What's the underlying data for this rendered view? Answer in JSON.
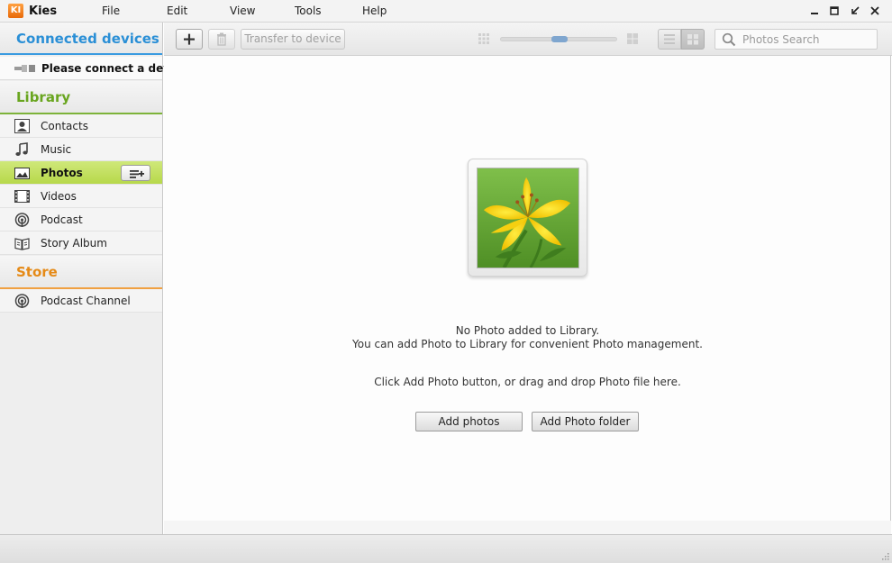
{
  "app": {
    "title": "Kies",
    "logo_text": "KI"
  },
  "menu": [
    "File",
    "Edit",
    "View",
    "Tools",
    "Help"
  ],
  "window_controls": {
    "menu": "▭",
    "minimize": "—",
    "maximize": "◻",
    "restore": "↙",
    "close": "✕"
  },
  "sidebar": {
    "connected_header": "Connected devices",
    "device_label": "Please connect a dev...",
    "library_header": "Library",
    "library_items": [
      {
        "label": "Contacts",
        "icon": "contacts-icon"
      },
      {
        "label": "Music",
        "icon": "music-icon"
      },
      {
        "label": "Photos",
        "icon": "photos-icon",
        "active": true
      },
      {
        "label": "Videos",
        "icon": "videos-icon"
      },
      {
        "label": "Podcast",
        "icon": "podcast-icon"
      },
      {
        "label": "Story Album",
        "icon": "story-album-icon"
      }
    ],
    "store_header": "Store",
    "store_items": [
      {
        "label": "Podcast Channel",
        "icon": "podcast-channel-icon"
      }
    ]
  },
  "toolbar": {
    "transfer_label": "Transfer to device",
    "search_placeholder": "Photos Search"
  },
  "main": {
    "empty_line1": "No Photo added to Library.",
    "empty_line2": "You can add Photo to Library for convenient Photo management.",
    "empty_line3": "Click Add Photo button, or drag and drop Photo file here.",
    "add_photos_label": "Add photos",
    "add_folder_label": "Add Photo folder"
  },
  "colors": {
    "connected": "#2a8fd6",
    "library": "#69a51f",
    "store": "#e58a17",
    "active_item": "#c4e05c"
  }
}
